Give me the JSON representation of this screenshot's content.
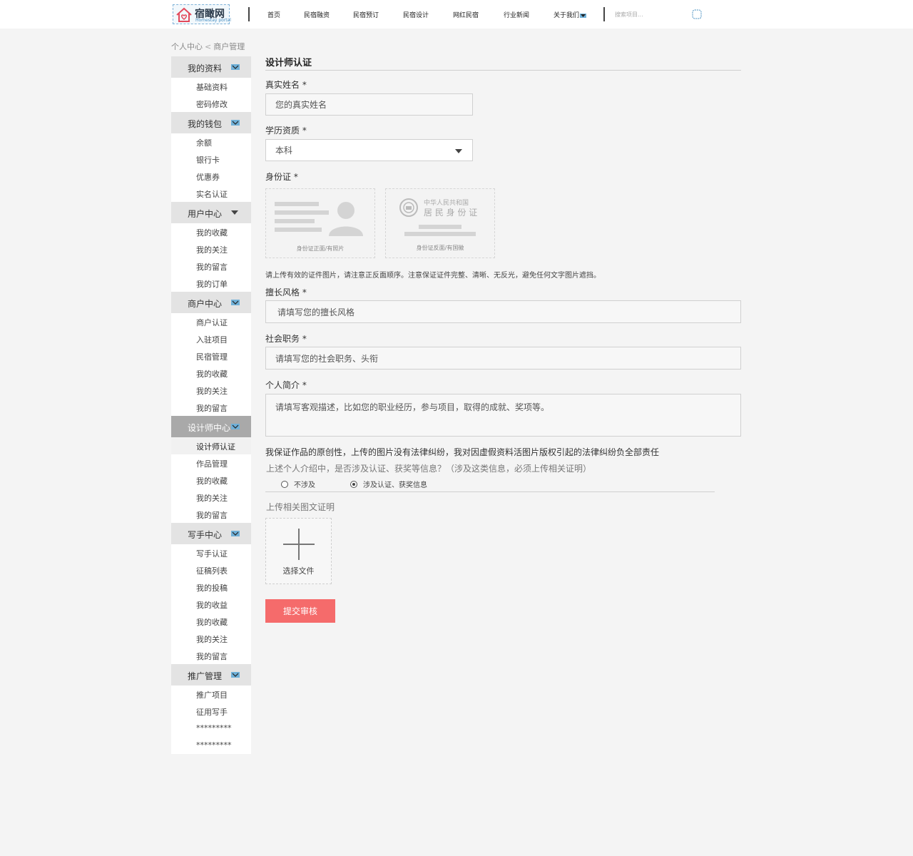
{
  "header": {
    "logo_text": "宿瞰网",
    "logo_subtext": "Homestay portal",
    "nav": [
      "首页",
      "民宿融资",
      "民宿预订",
      "民宿设计",
      "网红民宿",
      "行业新闻",
      "关于我们"
    ],
    "search_placeholder": "搜索项目..."
  },
  "breadcrumb": {
    "root": "个人中心",
    "separator": "<",
    "current": "商户管理"
  },
  "sidebar": [
    {
      "label": "我的资料",
      "icon": "envelope-icon",
      "items": [
        "基础资料",
        "密码修改"
      ]
    },
    {
      "label": "我的钱包",
      "icon": "envelope-icon",
      "items": [
        "余额",
        "银行卡",
        "优惠券",
        "实名认证"
      ]
    },
    {
      "label": "用户中心",
      "icon": "caret-down-icon",
      "items": [
        "我的收藏",
        "我的关注",
        "我的留言",
        "我的订单"
      ]
    },
    {
      "label": "商户中心",
      "icon": "envelope-icon",
      "items": [
        "商户认证",
        "入驻项目",
        "民宿管理",
        "我的收藏",
        "我的关注",
        "我的留言"
      ]
    },
    {
      "label": "设计师中心",
      "icon": "envelope-icon",
      "active": true,
      "items": [
        "设计师认证",
        "作品管理",
        "我的收藏",
        "我的关注",
        "我的留言"
      ],
      "active_item": "设计师认证"
    },
    {
      "label": "写手中心",
      "icon": "envelope-icon",
      "items": [
        "写手认证",
        "征稿列表",
        "我的投稿",
        "我的收益",
        "我的收藏",
        "我的关注",
        "我的留言"
      ]
    },
    {
      "label": "推广管理",
      "icon": "envelope-icon",
      "items": [
        "推广项目",
        "征用写手",
        "*********",
        "*********"
      ]
    }
  ],
  "form": {
    "title": "设计师认证",
    "name_label": "真实姓名 *",
    "name_placeholder": "您的真实姓名",
    "edu_label": "学历资质 *",
    "edu_value": "本科",
    "id_label": "身份证 *",
    "id_front_caption": "身份证正面/有照片",
    "id_back_caption": "身份证反面/有国徽",
    "id_back_title1": "中华人民共和国",
    "id_back_title2": "居 民 身 份 证",
    "id_hint": "请上传有效的证件图片，请注意正反面顺序。注意保证证件完整、清晰、无反光，避免任何文字图片遮挡。",
    "style_label": "擅长风格 *",
    "style_placeholder": "请填写您的擅长风格",
    "job_label": "社会职务 *",
    "job_placeholder": "请填写您的社会职务、头衔",
    "bio_label": "个人简介 *",
    "bio_placeholder": "请填写客观描述，比如您的职业经历，参与项目，取得的成就、奖项等。",
    "pledge": "我保证作品的原创性，上传的图片没有法律纠纷，我对因虚假资料活图片版权引起的法律纠纷负全部责任",
    "question": "上述个人介绍中，是否涉及认证、获奖等信息？（涉及这类信息，必须上传相关证明）",
    "radio_no": "不涉及",
    "radio_yes": "涉及认证、获奖信息",
    "selected_radio": "涉及认证、获奖信息",
    "upload_label": "上传相关图文证明",
    "upload_button": "选择文件",
    "submit": "提交审核"
  },
  "colors": {
    "accent": "#f56b6b",
    "sidebar_group_bg": "#e3e3e3",
    "sidebar_active_bg": "#a9a9a9"
  }
}
